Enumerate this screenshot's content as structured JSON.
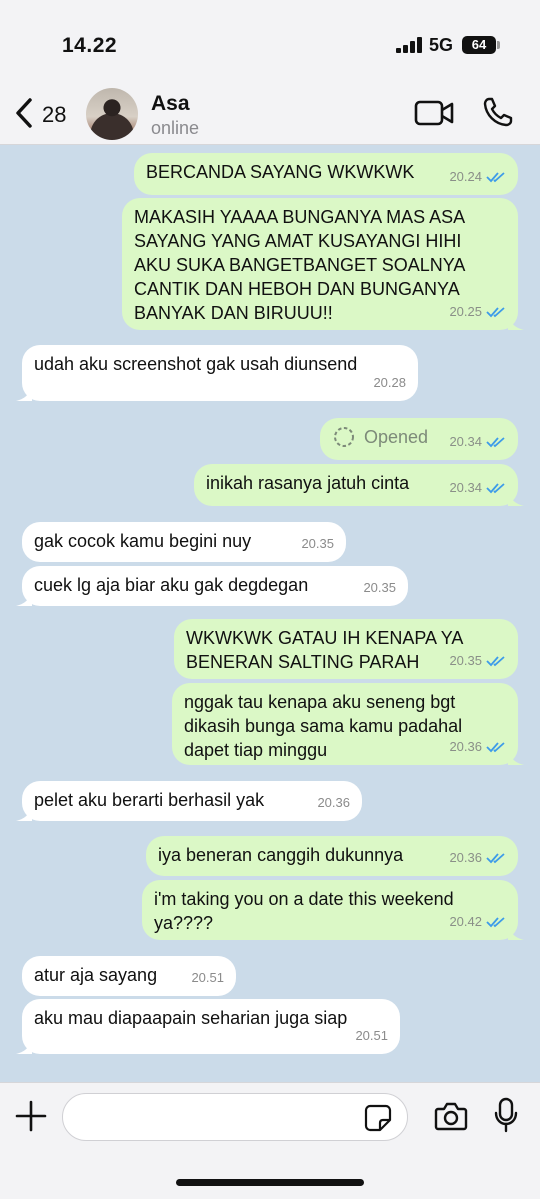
{
  "status_bar": {
    "time": "14.22",
    "network": "5G",
    "battery": "64"
  },
  "header": {
    "back_count": "28",
    "contact_name": "Asa",
    "contact_status": "online"
  },
  "messages": [
    {
      "text": "BERCANDA SAYANG WKWKWK",
      "time": "20.24"
    },
    {
      "text": "MAKASIH YAAAA BUNGANYA MAS ASA\nSAYANG YANG AMAT KUSAYANGI HIHI\nAKU SUKA BANGETBANGET SOALNYA\nCANTIK DAN HEBOH DAN BUNGANYA\nBANYAK DAN BIRUUU!!",
      "time": "20.25"
    },
    {
      "text": "udah aku screenshot gak usah diunsend",
      "time": "20.28"
    },
    {
      "text": "Opened",
      "time": "20.34"
    },
    {
      "text": "inikah rasanya jatuh cinta",
      "time": "20.34"
    },
    {
      "text": "gak cocok kamu begini nuy",
      "time": "20.35"
    },
    {
      "text": "cuek lg aja biar aku gak degdegan",
      "time": "20.35"
    },
    {
      "text": "WKWKWK GATAU IH KENAPA YA\nBENERAN SALTING PARAH",
      "time": "20.35"
    },
    {
      "text": "nggak tau kenapa aku seneng bgt\ndikasih bunga sama kamu padahal\ndapet tiap minggu",
      "time": "20.36"
    },
    {
      "text": "pelet aku berarti berhasil yak",
      "time": "20.36"
    },
    {
      "text": "iya beneran canggih dukunnya",
      "time": "20.36"
    },
    {
      "text": "i'm taking you on a date this weekend\nya????",
      "time": "20.42"
    },
    {
      "text": "atur aja sayang",
      "time": "20.51"
    },
    {
      "text": "aku mau diapaapain seharian juga siap",
      "time": "20.51"
    }
  ],
  "colors": {
    "outgoing": "#dbf8c6",
    "incoming": "#ffffff",
    "background": "#cbdbe9",
    "read_ticks": "#3d9be9"
  },
  "icons": [
    "back-chevron",
    "video-call",
    "phone",
    "plus",
    "sticker",
    "camera",
    "microphone",
    "double-check"
  ]
}
